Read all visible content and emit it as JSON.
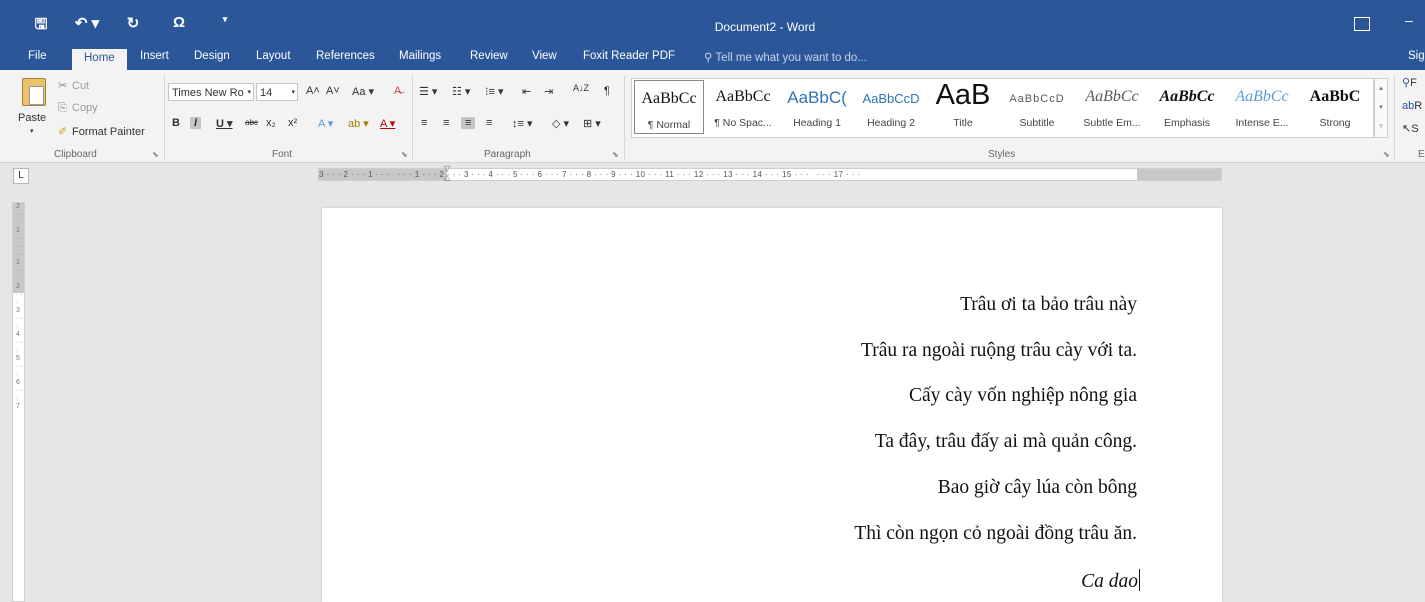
{
  "window": {
    "title": "Document2 - Word",
    "qat_icons": [
      "save-icon",
      "undo-icon",
      "redo-icon",
      "omega-icon",
      "qat-customize-icon"
    ],
    "qat_glyphs": [
      "🖫",
      "↶ ▾",
      "↻",
      "Ω",
      "▾"
    ],
    "ribbon_options_icon": "▣",
    "minimize_glyph": "–"
  },
  "tabs": [
    "File",
    "Home",
    "Insert",
    "Design",
    "Layout",
    "References",
    "Mailings",
    "Review",
    "View",
    "Foxit Reader PDF"
  ],
  "active_tab": "Home",
  "tell_me": "Tell me what you want to do...",
  "sign_in": "Sig",
  "clipboard": {
    "group": "Clipboard",
    "paste": "Paste",
    "cut": "Cut",
    "copy": "Copy",
    "format_painter": "Format Painter"
  },
  "font": {
    "group": "Font",
    "name": "Times New Ro",
    "size": "14",
    "row1": [
      "A˄",
      "A˅",
      "Aa ▾",
      "A̶"
    ],
    "row2": [
      "B",
      "I",
      "U ▾",
      "abc",
      "x₂",
      "x²",
      "A ▾",
      "ab ▾",
      "A ▾"
    ]
  },
  "paragraph": {
    "group": "Paragraph",
    "row1": [
      "☰ ▾",
      "☷ ▾",
      "⁝≡ ▾",
      "⇤",
      "⇥",
      "A↓Z",
      "¶"
    ],
    "row2": [
      "≡",
      "≡",
      "≡",
      "≡",
      "↕≡ ▾",
      "◇ ▾",
      "⊞ ▾"
    ]
  },
  "styles": {
    "group": "Styles",
    "items": [
      {
        "preview": "AaBbCc",
        "name": "¶ Normal"
      },
      {
        "preview": "AaBbCc",
        "name": "¶ No Spac..."
      },
      {
        "preview": "AaBbC(",
        "name": "Heading 1"
      },
      {
        "preview": "AaBbCcD",
        "name": "Heading 2"
      },
      {
        "preview": "AaB",
        "name": "Title"
      },
      {
        "preview": "AaBbCcD",
        "name": "Subtitle"
      },
      {
        "preview": "AaBbCc",
        "name": "Subtle Em..."
      },
      {
        "preview": "AaBbCc",
        "name": "Emphasis"
      },
      {
        "preview": "AaBbCc",
        "name": "Intense E..."
      },
      {
        "preview": "AaBbC",
        "name": "Strong"
      }
    ],
    "colors": {
      "heading": "#2e74b5",
      "intense": "#5b9bd5",
      "subtle": "#595959"
    }
  },
  "editing": {
    "find": "F",
    "replace": "R",
    "select": "S",
    "group": "E"
  },
  "ruler": {
    "corner": "L",
    "text": "3 · · · 2 · · · 1 · · ·   · · · 1 · · · 2 · · · 3 · · · 4 · · · 5 · · · 6 · · · 7 · · · 8 · · · 9 · · · 10 · · · 11 · · · 12 · · · 13 · · · 14 · · · 15 · · ·   · · · 17 · · ·",
    "vertical_ticks": "2 · · · 1 · · · · · · 1 · · · 2 · · · 3 · · · 4 · · · 5 · · · 6 · · · 7"
  },
  "document": {
    "lines": [
      "Trâu ơi ta bảo trâu này",
      "Trâu ra ngoài ruộng trâu cày với ta.",
      "Cấy cày vốn nghiệp nông gia",
      "Ta đây, trâu đấy ai mà quản công.",
      "Bao giờ cây lúa còn bông",
      "Thì còn ngọn cỏ ngoài đồng trâu ăn."
    ],
    "signature": "Ca dao"
  }
}
